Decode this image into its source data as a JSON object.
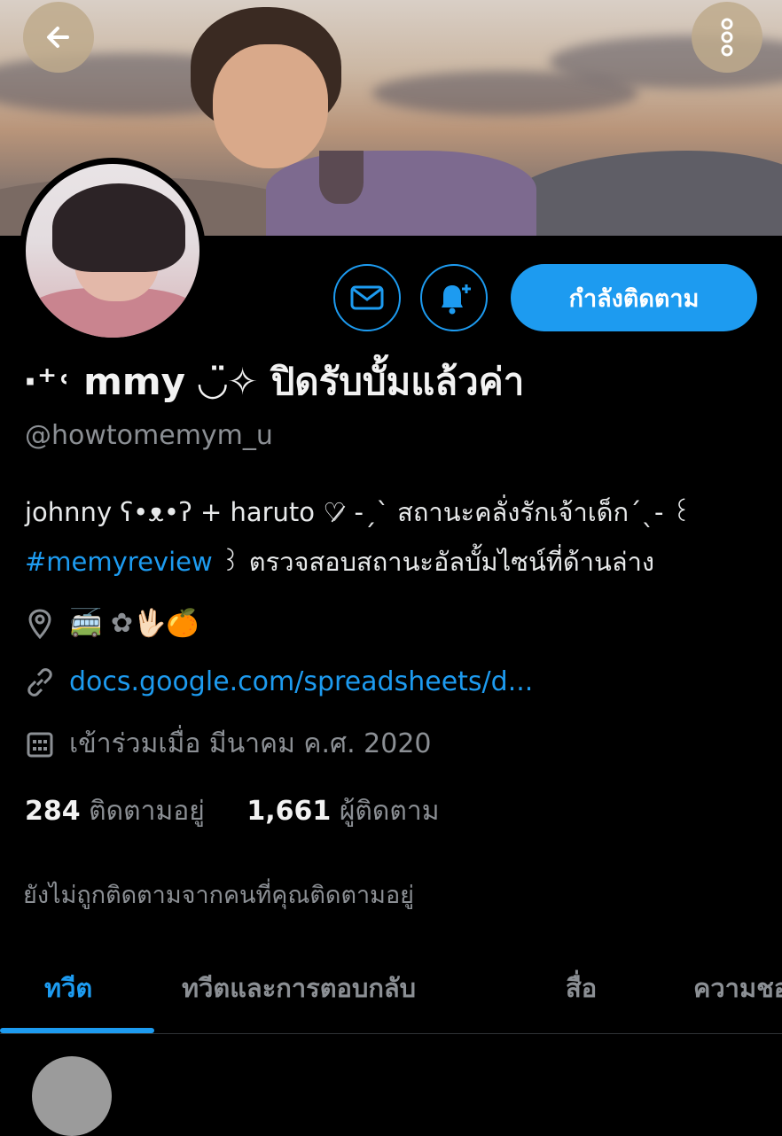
{
  "profile": {
    "display_name": "·⁺˓ mmy ◡̈✧ ปิดรับบั้มแล้วค่า",
    "handle": "@howtomemym_u",
    "bio_line1": "johnny ʕ•ᴥ•ʔ + haruto ♡̷ -ˏˋ สถานะคลั่งรักเจ้าเด็กˊˎ- ꒰",
    "bio_hashtag": "#memyreview",
    "bio_line2_rest": " ꒱ ตรวจสอบสถานะอัลบั้มไซน์ที่ด้านล่าง",
    "location": "🚎 ✿🖖🏻🍊",
    "website": "docs.google.com/spreadsheets/d...",
    "joined": "เข้าร่วมเมื่อ มีนาคม ค.ศ. 2020",
    "following_count": "284",
    "following_label": "ติดตามอยู่",
    "followers_count": "1,661",
    "followers_label": "ผู้ติดตาม",
    "not_followed_note": "ยังไม่ถูกติดตามจากคนที่คุณติดตามอยู่"
  },
  "actions": {
    "follow_label": "กำลังติดตาม",
    "message_icon": "envelope-icon",
    "notify_icon": "bell-plus-icon",
    "back_icon": "arrow-left-icon",
    "more_icon": "more-vertical-icon"
  },
  "tabs": [
    {
      "label": "ทวีต",
      "active": true
    },
    {
      "label": "ทวีตและการตอบกลับ",
      "active": false
    },
    {
      "label": "สื่อ",
      "active": false
    },
    {
      "label": "ความชอบ",
      "active": false
    }
  ],
  "colors": {
    "accent": "#1d9bf0",
    "background": "#000000",
    "muted_text": "#8b8f94"
  }
}
